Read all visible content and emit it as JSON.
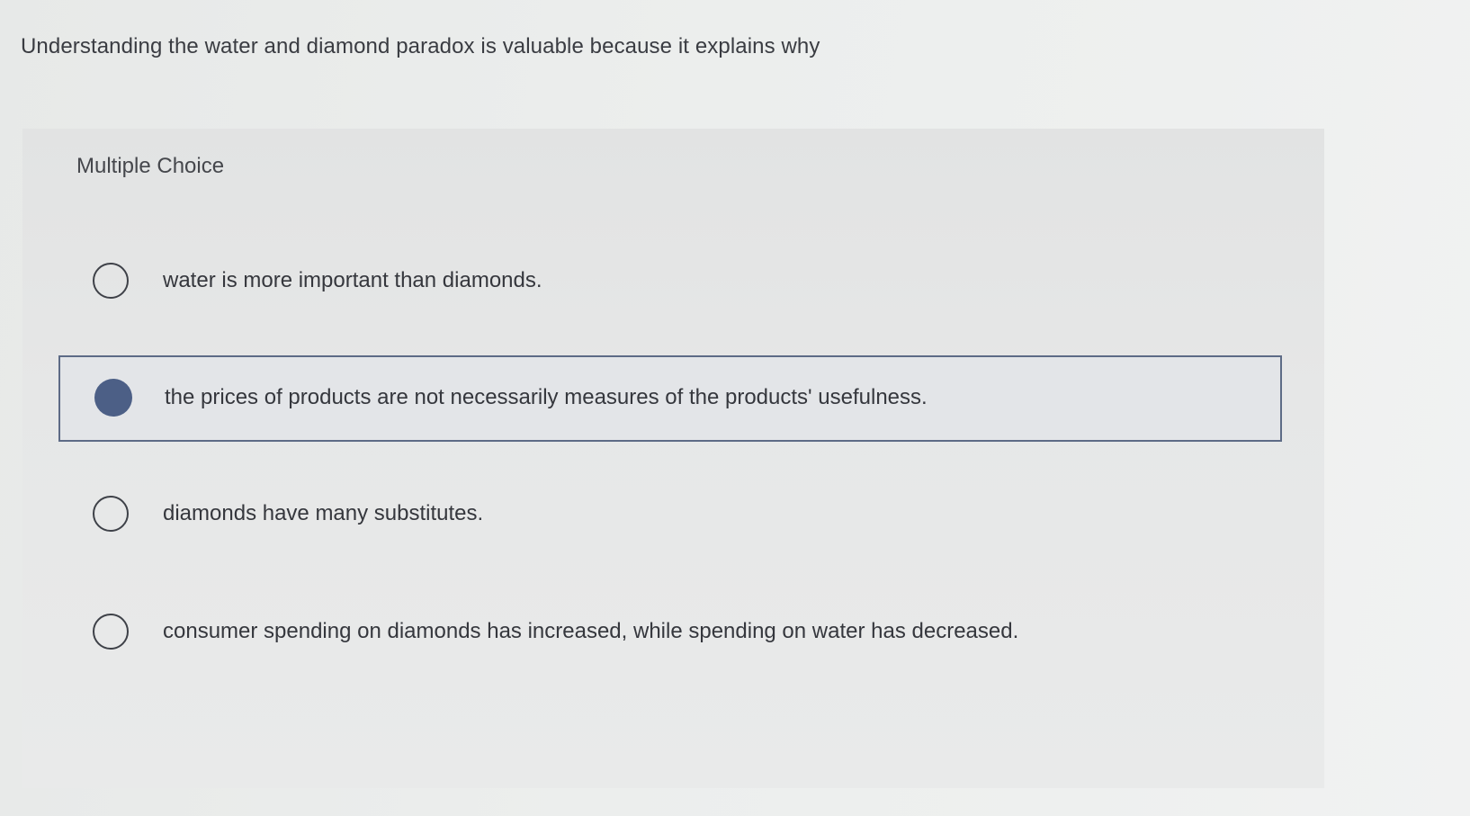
{
  "question": {
    "text": "Understanding the water and diamond paradox is valuable because it explains why"
  },
  "panel": {
    "type_label": "Multiple Choice"
  },
  "options": [
    {
      "label": "water is more important than diamonds.",
      "selected": false
    },
    {
      "label": "the prices of products are not necessarily measures of the products' usefulness.",
      "selected": true
    },
    {
      "label": "diamonds have many substitutes.",
      "selected": false
    },
    {
      "label": "consumer spending on diamonds has increased, while spending on water has decreased.",
      "selected": false
    }
  ],
  "colors": {
    "selected_fill": "#4c5f86",
    "selected_border": "#5d6b86",
    "panel_bg": "#e5e6e6"
  }
}
